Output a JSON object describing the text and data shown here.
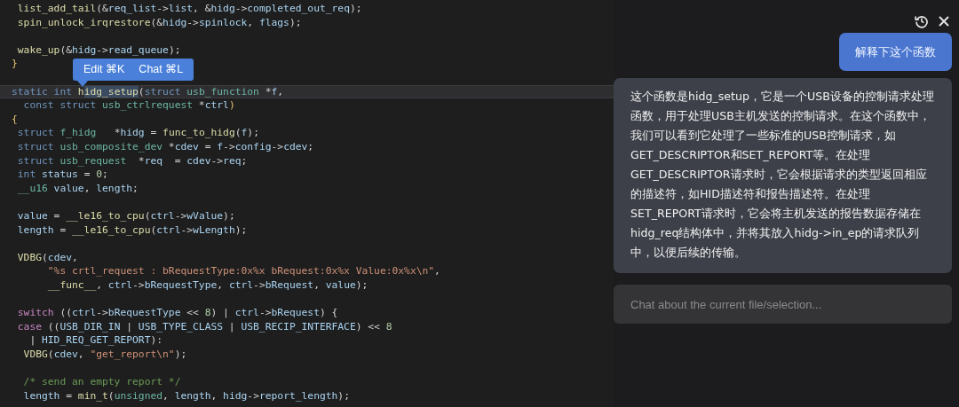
{
  "editor": {
    "lines": [
      {
        "kind": "code",
        "current": false,
        "tokens": [
          {
            "text": " list_add_tail",
            "kind": "f"
          },
          {
            "text": "(&",
            "kind": "p"
          },
          {
            "text": "req_list",
            "kind": "v"
          },
          {
            "text": "->",
            "kind": "p"
          },
          {
            "text": "list",
            "kind": "v"
          },
          {
            "text": ", &",
            "kind": "p"
          },
          {
            "text": "hidg",
            "kind": "v"
          },
          {
            "text": "->",
            "kind": "p"
          },
          {
            "text": "completed_out_req",
            "kind": "v"
          },
          {
            "text": ");",
            "kind": "p"
          }
        ]
      },
      {
        "kind": "code",
        "current": false,
        "tokens": [
          {
            "text": " spin_unlock_irqrestore",
            "kind": "f"
          },
          {
            "text": "(&",
            "kind": "p"
          },
          {
            "text": "hidg",
            "kind": "v"
          },
          {
            "text": "->",
            "kind": "p"
          },
          {
            "text": "spinlock",
            "kind": "v"
          },
          {
            "text": ", ",
            "kind": "p"
          },
          {
            "text": "flags",
            "kind": "v"
          },
          {
            "text": ");",
            "kind": "p"
          }
        ]
      },
      {
        "kind": "blank",
        "current": false
      },
      {
        "kind": "code",
        "current": false,
        "tokens": [
          {
            "text": " wake_up",
            "kind": "f"
          },
          {
            "text": "(&",
            "kind": "p"
          },
          {
            "text": "hidg",
            "kind": "v"
          },
          {
            "text": "->",
            "kind": "p"
          },
          {
            "text": "read_queue",
            "kind": "v"
          },
          {
            "text": ");",
            "kind": "p"
          }
        ]
      },
      {
        "kind": "code",
        "current": false,
        "tokens": [
          {
            "text": "}",
            "kind": "b"
          }
        ]
      },
      {
        "kind": "blank",
        "current": false
      },
      {
        "kind": "code",
        "current": true,
        "tokens": [
          {
            "text": "static int ",
            "kind": "k"
          },
          {
            "text": "h",
            "kind": "f"
          },
          {
            "text": "idg_setup",
            "kind": "sel"
          },
          {
            "text": "(",
            "kind": "p"
          },
          {
            "text": "struct ",
            "kind": "k"
          },
          {
            "text": "usb_function ",
            "kind": "t"
          },
          {
            "text": "*",
            "kind": "p"
          },
          {
            "text": "f",
            "kind": "v"
          },
          {
            "text": ",",
            "kind": "p"
          }
        ]
      },
      {
        "kind": "code",
        "current": false,
        "tokens": [
          {
            "text": "  const struct ",
            "kind": "k"
          },
          {
            "text": "usb_ctrlrequest ",
            "kind": "t"
          },
          {
            "text": "*",
            "kind": "p"
          },
          {
            "text": "ctrl",
            "kind": "v"
          },
          {
            "text": ")",
            "kind": "b"
          }
        ]
      },
      {
        "kind": "code",
        "current": false,
        "tokens": [
          {
            "text": "{",
            "kind": "b"
          }
        ]
      },
      {
        "kind": "code",
        "current": false,
        "tokens": [
          {
            "text": " struct ",
            "kind": "k"
          },
          {
            "text": "f_hidg   ",
            "kind": "t"
          },
          {
            "text": "*",
            "kind": "p"
          },
          {
            "text": "hidg",
            "kind": "v"
          },
          {
            "text": " = ",
            "kind": "p"
          },
          {
            "text": "func_to_hidg",
            "kind": "f"
          },
          {
            "text": "(",
            "kind": "p"
          },
          {
            "text": "f",
            "kind": "v"
          },
          {
            "text": ");",
            "kind": "p"
          }
        ]
      },
      {
        "kind": "code",
        "current": false,
        "tokens": [
          {
            "text": " struct ",
            "kind": "k"
          },
          {
            "text": "usb_composite_dev ",
            "kind": "t"
          },
          {
            "text": "*",
            "kind": "p"
          },
          {
            "text": "cdev",
            "kind": "v"
          },
          {
            "text": " = ",
            "kind": "p"
          },
          {
            "text": "f",
            "kind": "v"
          },
          {
            "text": "->",
            "kind": "p"
          },
          {
            "text": "config",
            "kind": "v"
          },
          {
            "text": "->",
            "kind": "p"
          },
          {
            "text": "cdev",
            "kind": "v"
          },
          {
            "text": ";",
            "kind": "p"
          }
        ]
      },
      {
        "kind": "code",
        "current": false,
        "tokens": [
          {
            "text": " struct ",
            "kind": "k"
          },
          {
            "text": "usb_request  ",
            "kind": "t"
          },
          {
            "text": "*",
            "kind": "p"
          },
          {
            "text": "req",
            "kind": "v"
          },
          {
            "text": "  = ",
            "kind": "p"
          },
          {
            "text": "cdev",
            "kind": "v"
          },
          {
            "text": "->",
            "kind": "p"
          },
          {
            "text": "req",
            "kind": "v"
          },
          {
            "text": ";",
            "kind": "p"
          }
        ]
      },
      {
        "kind": "code",
        "current": false,
        "tokens": [
          {
            "text": " int ",
            "kind": "k"
          },
          {
            "text": "status",
            "kind": "v"
          },
          {
            "text": " = ",
            "kind": "p"
          },
          {
            "text": "0",
            "kind": "n"
          },
          {
            "text": ";",
            "kind": "p"
          }
        ]
      },
      {
        "kind": "code",
        "current": false,
        "tokens": [
          {
            "text": " __u16 ",
            "kind": "t"
          },
          {
            "text": "value",
            "kind": "v"
          },
          {
            "text": ", ",
            "kind": "p"
          },
          {
            "text": "length",
            "kind": "v"
          },
          {
            "text": ";",
            "kind": "p"
          }
        ]
      },
      {
        "kind": "blank",
        "current": false
      },
      {
        "kind": "code",
        "current": false,
        "tokens": [
          {
            "text": " value",
            "kind": "v"
          },
          {
            "text": " = ",
            "kind": "p"
          },
          {
            "text": "__le16_to_cpu",
            "kind": "f"
          },
          {
            "text": "(",
            "kind": "p"
          },
          {
            "text": "ctrl",
            "kind": "v"
          },
          {
            "text": "->",
            "kind": "p"
          },
          {
            "text": "wValue",
            "kind": "v"
          },
          {
            "text": ");",
            "kind": "p"
          }
        ]
      },
      {
        "kind": "code",
        "current": false,
        "tokens": [
          {
            "text": " length",
            "kind": "v"
          },
          {
            "text": " = ",
            "kind": "p"
          },
          {
            "text": "__le16_to_cpu",
            "kind": "f"
          },
          {
            "text": "(",
            "kind": "p"
          },
          {
            "text": "ctrl",
            "kind": "v"
          },
          {
            "text": "->",
            "kind": "p"
          },
          {
            "text": "wLength",
            "kind": "v"
          },
          {
            "text": ");",
            "kind": "p"
          }
        ]
      },
      {
        "kind": "blank",
        "current": false
      },
      {
        "kind": "code",
        "current": false,
        "tokens": [
          {
            "text": " VDBG",
            "kind": "f"
          },
          {
            "text": "(",
            "kind": "p"
          },
          {
            "text": "cdev",
            "kind": "v"
          },
          {
            "text": ",",
            "kind": "p"
          }
        ]
      },
      {
        "kind": "code",
        "current": false,
        "tokens": [
          {
            "text": "      \"%s crtl_request : bRequestType:0x%x bRequest:0x%x Value:0x%x\\n\"",
            "kind": "s"
          },
          {
            "text": ",",
            "kind": "p"
          }
        ]
      },
      {
        "kind": "code",
        "current": false,
        "tokens": [
          {
            "text": "      __func__",
            "kind": "f"
          },
          {
            "text": ", ",
            "kind": "p"
          },
          {
            "text": "ctrl",
            "kind": "v"
          },
          {
            "text": "->",
            "kind": "p"
          },
          {
            "text": "bRequestType",
            "kind": "v"
          },
          {
            "text": ", ",
            "kind": "p"
          },
          {
            "text": "ctrl",
            "kind": "v"
          },
          {
            "text": "->",
            "kind": "p"
          },
          {
            "text": "bRequest",
            "kind": "v"
          },
          {
            "text": ", ",
            "kind": "p"
          },
          {
            "text": "value",
            "kind": "v"
          },
          {
            "text": ");",
            "kind": "p"
          }
        ]
      },
      {
        "kind": "blank",
        "current": false
      },
      {
        "kind": "code",
        "current": false,
        "tokens": [
          {
            "text": " switch",
            "kind": "c"
          },
          {
            "text": " ((",
            "kind": "p"
          },
          {
            "text": "ctrl",
            "kind": "v"
          },
          {
            "text": "->",
            "kind": "p"
          },
          {
            "text": "bRequestType",
            "kind": "v"
          },
          {
            "text": " << ",
            "kind": "p"
          },
          {
            "text": "8",
            "kind": "n"
          },
          {
            "text": ") | ",
            "kind": "p"
          },
          {
            "text": "ctrl",
            "kind": "v"
          },
          {
            "text": "->",
            "kind": "p"
          },
          {
            "text": "bRequest",
            "kind": "v"
          },
          {
            "text": ") {",
            "kind": "p"
          }
        ]
      },
      {
        "kind": "code",
        "current": false,
        "tokens": [
          {
            "text": " case",
            "kind": "c"
          },
          {
            "text": " ((",
            "kind": "p"
          },
          {
            "text": "USB_DIR_IN",
            "kind": "v"
          },
          {
            "text": " | ",
            "kind": "p"
          },
          {
            "text": "USB_TYPE_CLASS",
            "kind": "v"
          },
          {
            "text": " | ",
            "kind": "p"
          },
          {
            "text": "USB_RECIP_INTERFACE",
            "kind": "v"
          },
          {
            "text": ") << ",
            "kind": "p"
          },
          {
            "text": "8",
            "kind": "n"
          }
        ]
      },
      {
        "kind": "code",
        "current": false,
        "tokens": [
          {
            "text": "   | ",
            "kind": "p"
          },
          {
            "text": "HID_REQ_GET_REPORT",
            "kind": "v"
          },
          {
            "text": "):",
            "kind": "p"
          }
        ]
      },
      {
        "kind": "code",
        "current": false,
        "tokens": [
          {
            "text": "  VDBG",
            "kind": "f"
          },
          {
            "text": "(",
            "kind": "p"
          },
          {
            "text": "cdev",
            "kind": "v"
          },
          {
            "text": ", ",
            "kind": "p"
          },
          {
            "text": "\"get_report\\n\"",
            "kind": "s"
          },
          {
            "text": ");",
            "kind": "p"
          }
        ]
      },
      {
        "kind": "blank",
        "current": false
      },
      {
        "kind": "code",
        "current": false,
        "tokens": [
          {
            "text": "  /* send an empty report */",
            "kind": "m"
          }
        ]
      },
      {
        "kind": "code",
        "current": false,
        "tokens": [
          {
            "text": "  length",
            "kind": "v"
          },
          {
            "text": " = ",
            "kind": "p"
          },
          {
            "text": "min_t",
            "kind": "f"
          },
          {
            "text": "(",
            "kind": "p"
          },
          {
            "text": "unsigned",
            "kind": "t"
          },
          {
            "text": ", ",
            "kind": "p"
          },
          {
            "text": "length",
            "kind": "v"
          },
          {
            "text": ", ",
            "kind": "p"
          },
          {
            "text": "hidg",
            "kind": "v"
          },
          {
            "text": "->",
            "kind": "p"
          },
          {
            "text": "report_length",
            "kind": "v"
          },
          {
            "text": ");",
            "kind": "p"
          }
        ]
      }
    ]
  },
  "selection_popup": {
    "actions": [
      {
        "label": "Edit",
        "shortcut": "⌘K"
      },
      {
        "label": "Chat",
        "shortcut": "⌘L"
      }
    ]
  },
  "chat": {
    "user_message": "解释下这个函数",
    "assistant_message": "这个函数是hidg_setup，它是一个USB设备的控制请求处理函数，用于处理USB主机发送的控制请求。在这个函数中，我们可以看到它处理了一些标准的USB控制请求，如GET_DESCRIPTOR和SET_REPORT等。在处理GET_DESCRIPTOR请求时，它会根据请求的类型返回相应的描述符，如HID描述符和报告描述符。在处理SET_REPORT请求时，它会将主机发送的报告数据存储在hidg_req结构体中，并将其放入hidg->in_ep的请求队列中，以便后续的传输。",
    "input": {
      "placeholder": "Chat about the current file/selection..."
    }
  }
}
